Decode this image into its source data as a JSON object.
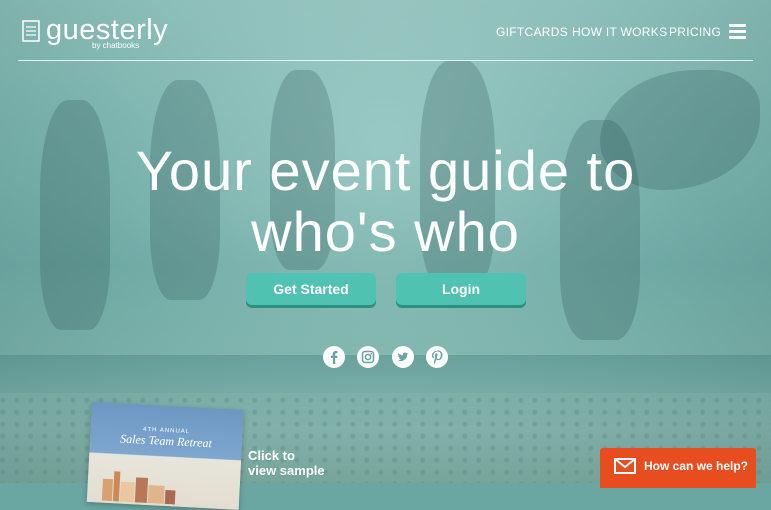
{
  "header": {
    "logo_text": "guesterly",
    "logo_sub": "by chatbooks",
    "nav": {
      "giftcards": "GIFTCARDS",
      "how_it_works": "HOW IT WORKS",
      "pricing": "PRICING"
    }
  },
  "hero": {
    "headline_line1": "Your event guide to",
    "headline_line2": "who's who",
    "get_started_label": "Get Started",
    "login_label": "Login"
  },
  "social": {
    "icons": [
      "facebook-icon",
      "instagram-icon",
      "twitter-icon",
      "pinterest-icon"
    ]
  },
  "sample": {
    "booklet_kicker": "4TH ANNUAL",
    "booklet_title": "Sales Team Retreat",
    "cta_line1": "Click to",
    "cta_line2": "view sample"
  },
  "help_widget": {
    "label": "How can we help?",
    "icon": "mail-icon"
  },
  "colors": {
    "accent": "#4fc2b1",
    "help": "#e84d1f",
    "overlay": "#6aa6a2"
  }
}
